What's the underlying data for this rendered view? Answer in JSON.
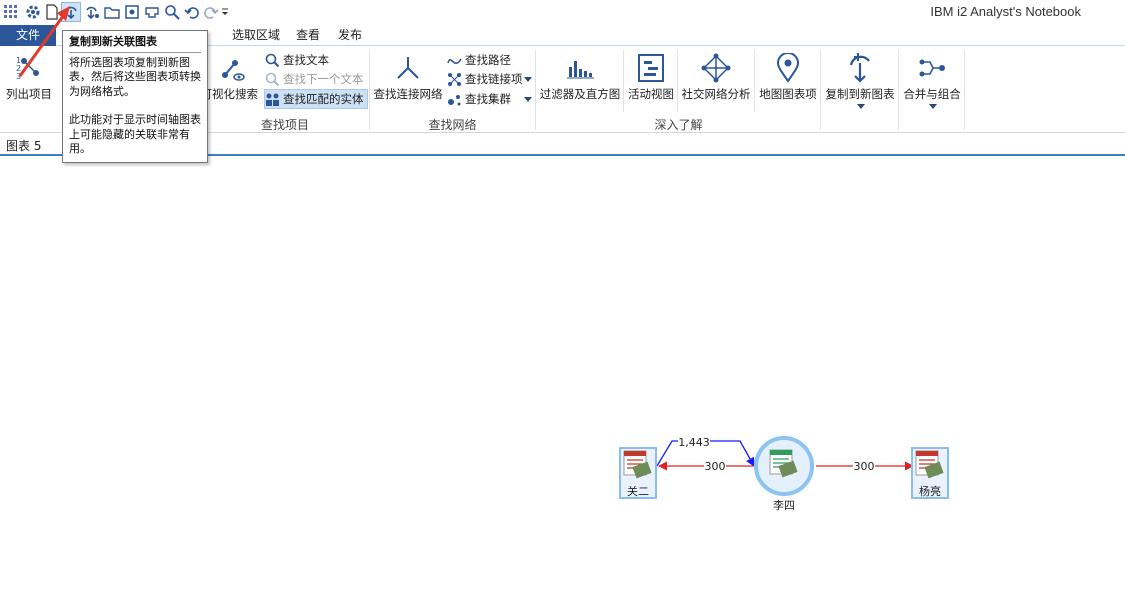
{
  "app": {
    "title": "IBM i2 Analyst's Notebook"
  },
  "tabs": [
    "文件",
    "选取区域",
    "查看",
    "发布"
  ],
  "ribbon": {
    "list_items_label": "列出项目",
    "visual_search_label": "可视化搜索",
    "find_text_label": "查找文本",
    "find_next_label": "查找下一个文本",
    "find_matching_label": "查找匹配的实体",
    "find_items_group": "查找项目",
    "find_network_label": "查找连接网络",
    "find_path_label": "查找路径",
    "find_link_items_label": "查找链接项",
    "find_clusters_label": "查找集群",
    "find_network_group": "查找网络",
    "filters_label": "过滤器及直方图",
    "activity_view_label": "活动视图",
    "sna_label": "社交网络分析",
    "map_items_label": "地图图表项",
    "copy_to_new_chart_label": "复制到新图表",
    "merge_combine_label": "合并与组合",
    "insight_group": "深入了解"
  },
  "tooltip": {
    "title": "复制到新关联图表",
    "body": "将所选图表项复制到新图表，然后将这些图表项转换为网络格式。",
    "body2": "此功能对于显示时间轴图表上可能隐藏的关联非常有用。"
  },
  "document": {
    "tab_label": "图表 5"
  },
  "chart": {
    "nodes": [
      {
        "id": "guan",
        "label": "关二"
      },
      {
        "id": "li",
        "label": "李四"
      },
      {
        "id": "yang",
        "label": "杨亮"
      }
    ],
    "links": [
      {
        "from": "guan",
        "to": "li",
        "label": "1,443",
        "color": "#1a1aff"
      },
      {
        "from": "li",
        "to": "guan",
        "label": "300",
        "color": "#e02020"
      },
      {
        "from": "li",
        "to": "yang",
        "label": "300",
        "color": "#e02020"
      }
    ]
  },
  "colors": {
    "accent": "#2b579a",
    "annotation_arrow": "#e03a2a"
  }
}
